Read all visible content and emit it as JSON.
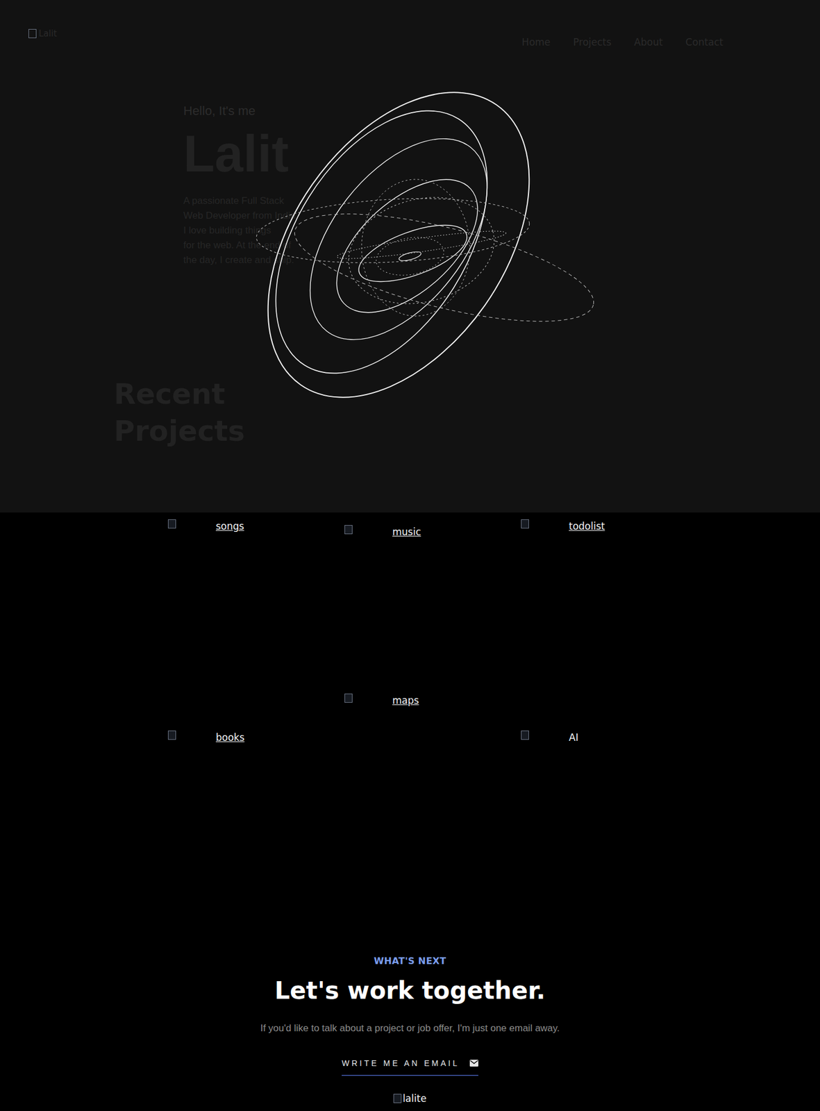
{
  "logo": {
    "alt": "Lalit"
  },
  "nav": [
    {
      "label": "Home"
    },
    {
      "label": "Projects"
    },
    {
      "label": "About"
    },
    {
      "label": "Contact"
    }
  ],
  "hero": {
    "greeting": "Hello, It's me",
    "name": "Lalit",
    "paragraph": [
      "A passionate Full Stack",
      "Web Developer from India.",
      "I love building things",
      "for the web. At the end of",
      "the day, I create and ship."
    ]
  },
  "section_title": "Recent Projects",
  "projects": [
    [
      {
        "label": "songs",
        "linked": true
      },
      {
        "label": "books",
        "linked": true
      }
    ],
    [
      {
        "label": "music",
        "linked": true
      },
      {
        "label": "maps",
        "linked": true
      }
    ],
    [
      {
        "label": "todolist",
        "linked": true
      },
      {
        "label": "AI",
        "linked": false
      }
    ]
  ],
  "contact": {
    "eyebrow": "WHAT'S NEXT",
    "title": "Let's work together.",
    "text": "If you'd like to talk about a project or job offer, I'm just one email away.",
    "button": "WRITE ME AN EMAIL",
    "footer_alt": "lalite"
  }
}
